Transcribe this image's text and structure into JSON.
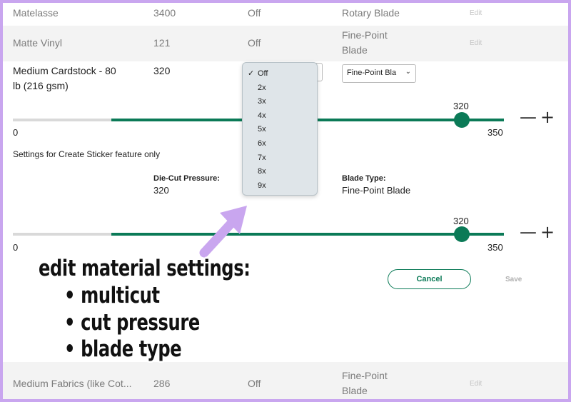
{
  "rows_top": [
    {
      "name": "Matelasse",
      "pressure": "3400",
      "multicut": "Off",
      "blade": "Rotary Blade",
      "edit": "Edit"
    },
    {
      "name": "Matte Vinyl",
      "pressure": "121",
      "multicut": "Off",
      "blade_line1": "Fine-Point",
      "blade_line2": "Blade",
      "edit": "Edit"
    }
  ],
  "editing": {
    "name_line1": "Medium Cardstock - 80",
    "name_line2": "lb (216 gsm)",
    "pressure": "320",
    "blade_select": "Fine-Point Bla",
    "slider1": {
      "value_label": "320",
      "min": "0",
      "max": "350",
      "level": 320
    },
    "sticker_note": "Settings for Create Sticker feature only",
    "die_cut_label": "Die-Cut Pressure:",
    "die_cut_value": "320",
    "blade_type_label": "Blade Type:",
    "blade_type_value": "Fine-Point Blade",
    "slider2": {
      "value_label": "320",
      "min": "0",
      "max": "350",
      "level": 320
    },
    "minus": "—",
    "plus": "+",
    "cancel": "Cancel",
    "save": "Save"
  },
  "multicut_dropdown": {
    "options": [
      "Off",
      "2x",
      "3x",
      "4x",
      "5x",
      "6x",
      "7x",
      "8x",
      "9x"
    ],
    "selected": "Off",
    "check": "✓"
  },
  "row_bottom": {
    "name": "Medium Fabrics (like Cot...",
    "pressure": "286",
    "multicut": "Off",
    "blade_line1": "Fine-Point",
    "blade_line2": "Blade",
    "edit": "Edit"
  },
  "annotation": {
    "title": "edit material settings:",
    "bullets": [
      "multicut",
      "cut pressure",
      "blade type"
    ],
    "bullet_char": "•"
  },
  "colors": {
    "accent": "#0b7a57",
    "frame": "#c9a6ef",
    "arrow": "#c9a6ef"
  }
}
